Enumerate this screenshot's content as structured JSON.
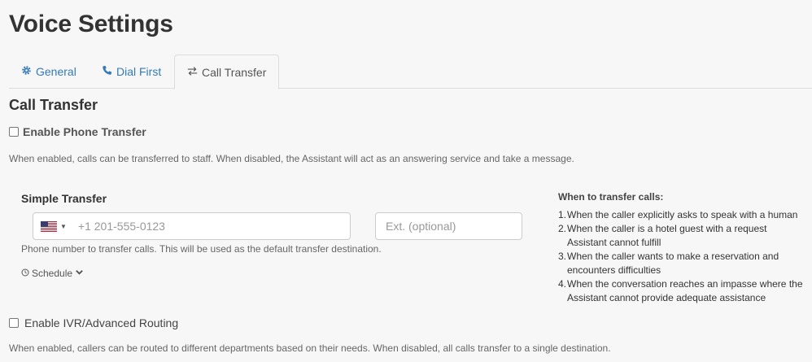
{
  "page": {
    "title": "Voice Settings"
  },
  "tabs": [
    {
      "label": "General",
      "icon": "gear-icon"
    },
    {
      "label": "Dial First",
      "icon": "phone-icon"
    },
    {
      "label": "Call Transfer",
      "icon": "transfer-arrows-icon",
      "active": true
    }
  ],
  "section": {
    "title": "Call Transfer"
  },
  "enable_phone_transfer": {
    "label": "Enable Phone Transfer",
    "checked": false,
    "help": "When enabled, calls can be transferred to staff. When disabled, the Assistant will act as an answering service and take a message."
  },
  "simple_transfer": {
    "heading": "Simple Transfer",
    "country_flag": "us-flag-icon",
    "phone_placeholder": "+1 201-555-0123",
    "ext_placeholder": "Ext. (optional)",
    "help": "Phone number to transfer calls. This will be used as the default transfer destination.",
    "schedule_label": "Schedule"
  },
  "when_to_transfer": {
    "title": "When to transfer calls:",
    "items": [
      "When the caller explicitly asks to speak with a human",
      "When the caller is a hotel guest with a request Assistant cannot fulfill",
      "When the caller wants to make a reservation and encounters difficulties",
      "When the conversation reaches an impasse where the Assistant cannot provide adequate assistance"
    ]
  },
  "enable_ivr": {
    "label": "Enable IVR/Advanced Routing",
    "checked": false,
    "help": "When enabled, callers can be routed to different departments based on their needs. When disabled, all calls transfer to a single destination."
  },
  "colors": {
    "link": "#337ab7",
    "text": "#333333",
    "muted": "#666666",
    "background": "#f7f7f7"
  }
}
